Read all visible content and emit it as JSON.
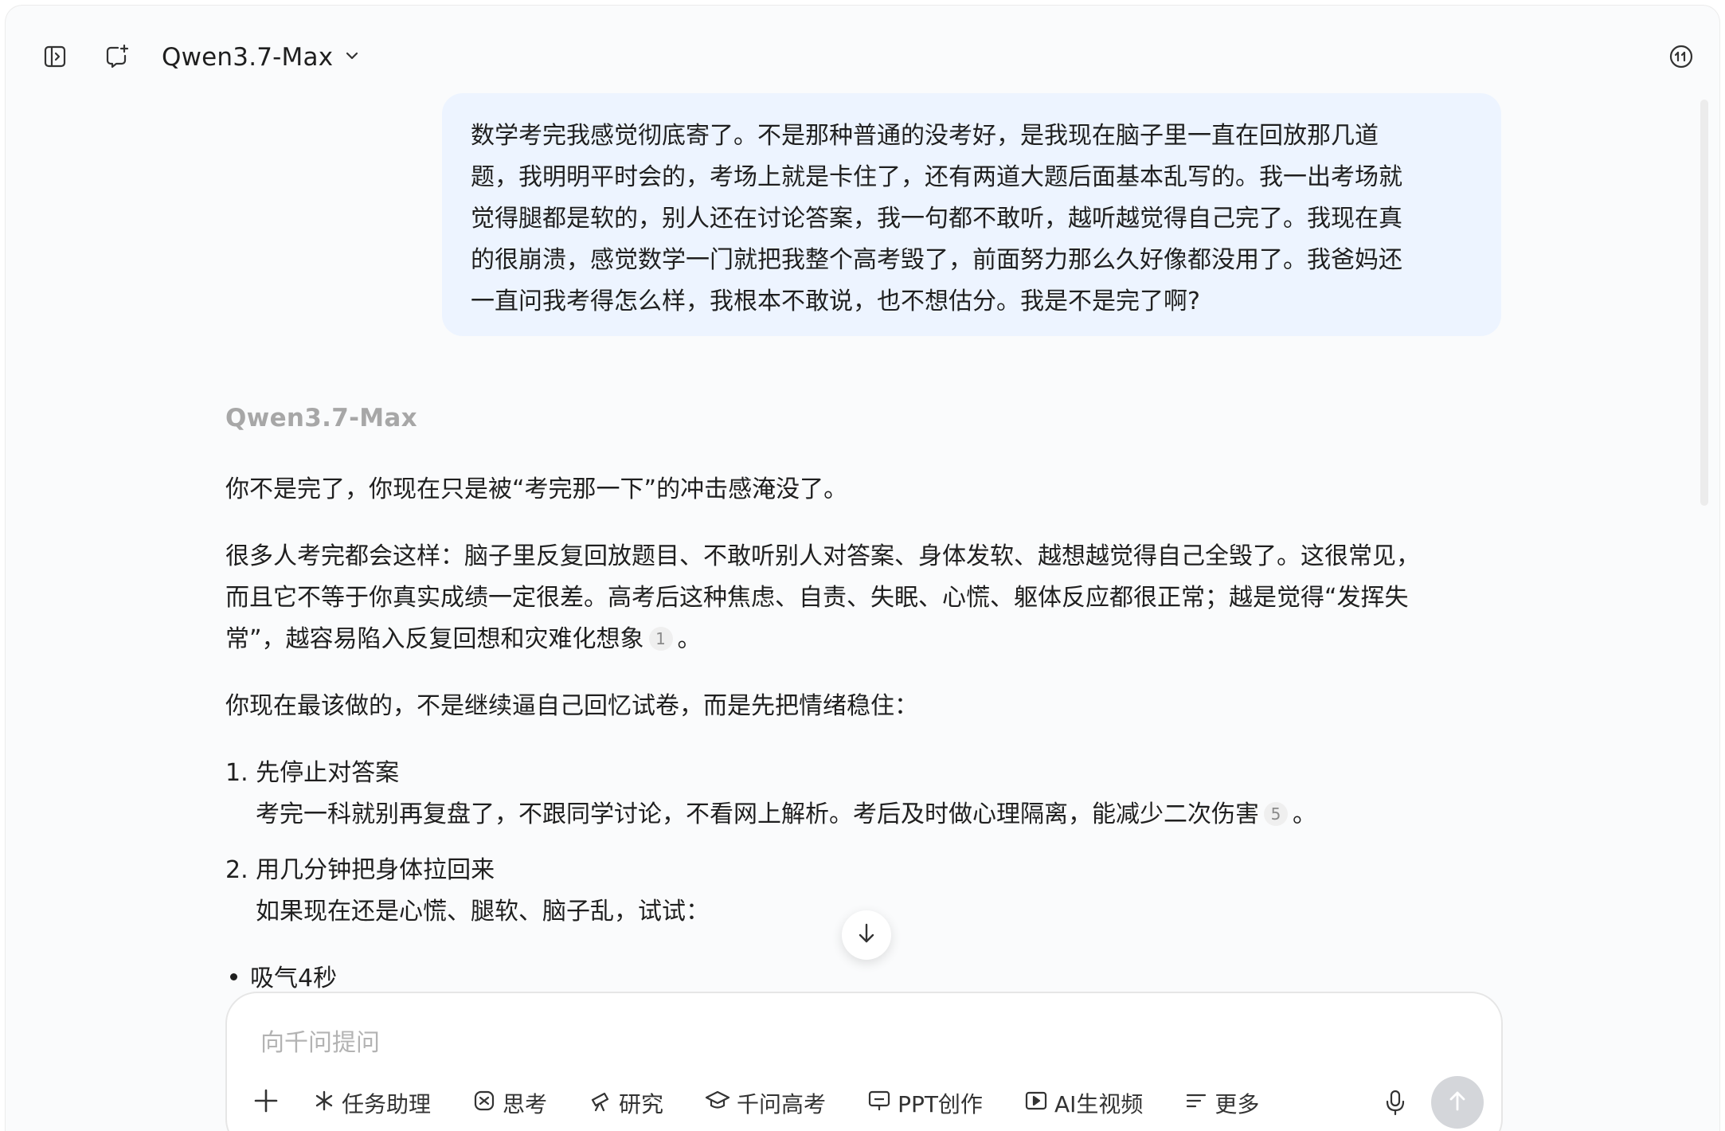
{
  "header": {
    "model_name": "Qwen3.7-Max",
    "icons": [
      "sidebar-toggle-icon",
      "new-chat-icon",
      "chevron-down-icon",
      "history-icon"
    ]
  },
  "user_message": {
    "lines": [
      "数学考完我感觉彻底寄了。不是那种普通的没考好，是我现在脑子里一直在回放那几道",
      "题，我明明平时会的，考场上就是卡住了，还有两道大题后面基本乱写的。我一出考场就",
      "觉得腿都是软的，别人还在讨论答案，我一句都不敢听，越听越觉得自己完了。我现在真",
      "的很崩溃，感觉数学一门就把我整个高考毁了，前面努力那么久好像都没用了。我爸妈还",
      "一直问我考得怎么样，我根本不敢说，也不想估分。我是不是完了啊?"
    ]
  },
  "assistant": {
    "name": "Qwen3.7-Max",
    "para1": "你不是完了，你现在只是被“考完那一下”的冲击感淹没了。",
    "para2_line1": "很多人考完都会这样：脑子里反复回放题目、不敢听别人对答案、身体发软、越想越觉得自己全毁了。这很常见，",
    "para2_line2": "而且它不等于你真实成绩一定很差。高考后这种焦虑、自责、失眠、心慌、躯体反应都很正常；越是觉得“发挥失",
    "para2_line3": "常”，越容易陷入反复回想和灾难化想象",
    "para2_ref": "1",
    "para2_end": "。",
    "para3": "你现在最该做的，不是继续逼自己回忆试卷，而是先把情绪稳住：",
    "item1_title": "1. 先停止对答案",
    "item1_body": "考完一科就别再复盘了，不跟同学讨论，不看网上解析。考后及时做心理隔离，能减少二次伤害",
    "item1_ref": "5",
    "item1_end": "。",
    "item2_title": "2. 用几分钟把身体拉回来",
    "item2_body": "如果现在还是心慌、腿软、脑子乱，试试：",
    "bullet1": "吸气4秒"
  },
  "composer": {
    "placeholder": "向千问提问",
    "tools": [
      {
        "label": "任务助理",
        "icon": "sparkle-icon"
      },
      {
        "label": "思考",
        "icon": "brain-icon"
      },
      {
        "label": "研究",
        "icon": "telescope-icon"
      },
      {
        "label": "千问高考",
        "icon": "graduation-cap-icon"
      },
      {
        "label": "PPT创作",
        "icon": "presentation-icon"
      },
      {
        "label": "AI生视频",
        "icon": "video-play-icon"
      },
      {
        "label": "更多",
        "icon": "menu-lines-icon"
      }
    ]
  },
  "colors": {
    "user_bubble": "#edf4ff",
    "assistant_name": "#a7a7a7",
    "send_button": "#d4d6da"
  }
}
